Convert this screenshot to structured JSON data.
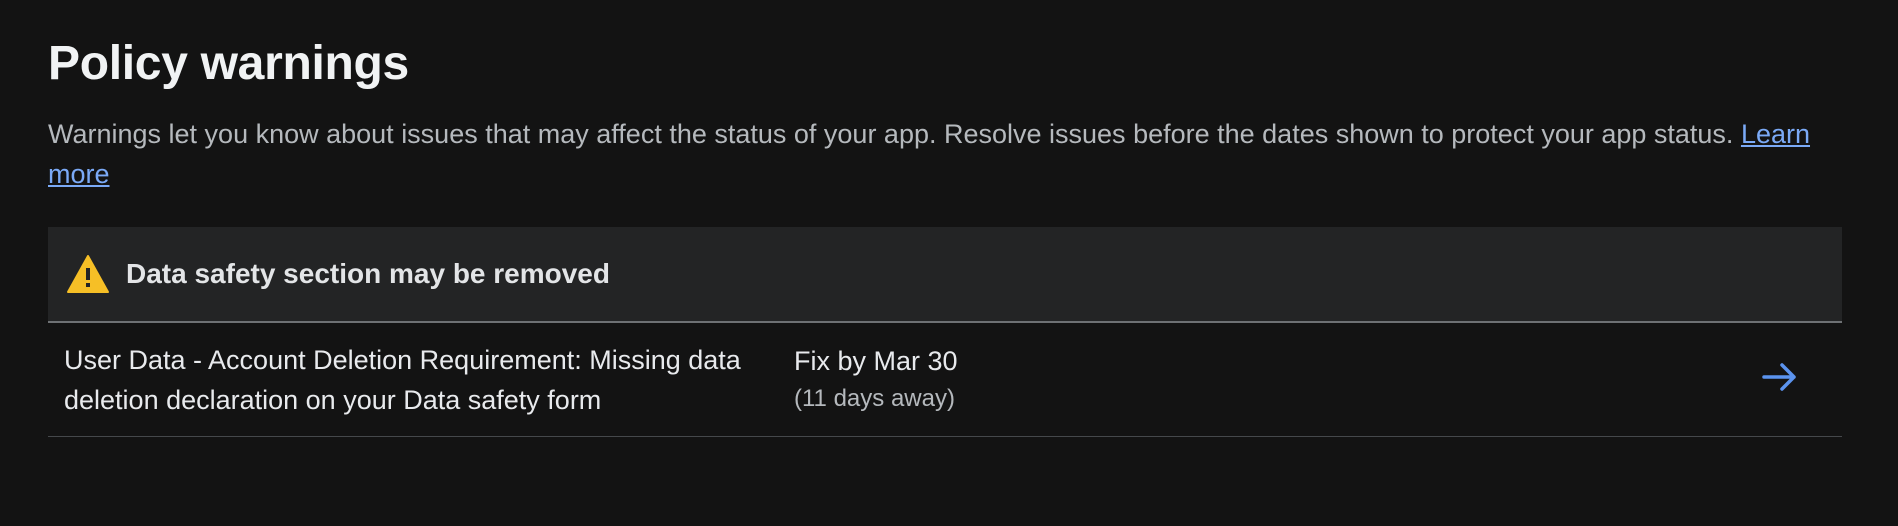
{
  "header": {
    "title": "Policy warnings",
    "description": "Warnings let you know about issues that may affect the status of your app. Resolve issues before the dates shown to protect your app status.",
    "learn_more_label": "Learn more"
  },
  "warning_card": {
    "icon": "warning-triangle-icon",
    "title": "Data safety section may be removed",
    "issues": [
      {
        "text": "User Data - Account Deletion Requirement: Missing data deletion declaration on your Data safety form",
        "due": "Fix by Mar 30",
        "due_relative": "(11 days away)",
        "action_icon": "arrow-right-icon"
      }
    ]
  },
  "colors": {
    "background": "#131313",
    "warning": "#f6bf26",
    "link": "#7baaf7",
    "accent_arrow": "#5b93ee"
  }
}
